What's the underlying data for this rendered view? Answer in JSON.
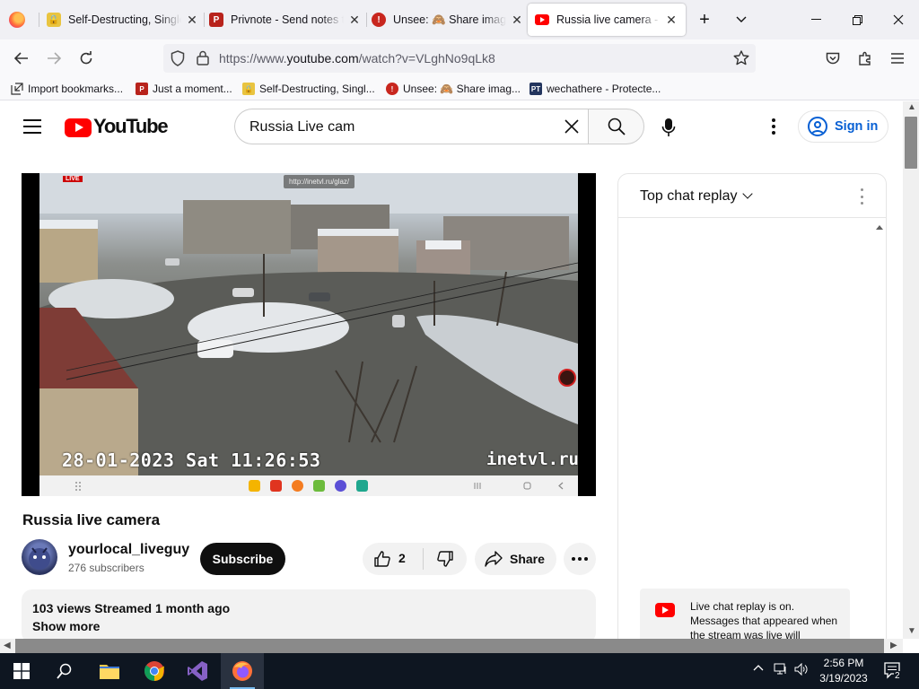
{
  "browser": {
    "tabs": [
      {
        "title": "Self-Destructing, Single",
        "favicon": "lock-gold-icon",
        "active": false
      },
      {
        "title": "Privnote - Send notes th",
        "favicon": "privnote-icon",
        "active": false
      },
      {
        "title": "Unsee: 🙈 Share image",
        "favicon": "unsee-icon",
        "active": false
      },
      {
        "title": "Russia live camera - You",
        "favicon": "youtube-icon",
        "active": true
      }
    ],
    "url": {
      "prefix": "https://www.",
      "domain": "youtube.com",
      "path": "/watch?v=VLghNo9qLk8"
    },
    "bookmarks": [
      {
        "label": "Import bookmarks...",
        "icon": "import-icon"
      },
      {
        "label": "Just a moment...",
        "icon": "privnote-icon"
      },
      {
        "label": "Self-Destructing, Singl...",
        "icon": "lock-gold-icon"
      },
      {
        "label": "Unsee: 🙈 Share imag...",
        "icon": "unsee-icon"
      },
      {
        "label": "wechathere - Protecte...",
        "icon": "pt-icon"
      }
    ],
    "pt_badge": "PT"
  },
  "youtube": {
    "logo_text": "YouTube",
    "search_value": "Russia Live cam",
    "sign_in_label": "Sign in"
  },
  "video": {
    "title": "Russia live camera",
    "overlay": {
      "timestamp": "28-01-2023 Sat 11:26:53",
      "brand": "inetvl.ru",
      "url": "http://inetvl.ru/glaz/",
      "live_badge": "LIVE"
    }
  },
  "channel": {
    "name": "yourlocal_liveguy",
    "subscribers": "276 subscribers",
    "subscribe_label": "Subscribe"
  },
  "actions": {
    "like_count": "2",
    "share_label": "Share"
  },
  "description": {
    "meta": "103 views  Streamed 1 month ago",
    "show_more": "Show more"
  },
  "chat": {
    "title": "Top chat replay",
    "notice": "Live chat replay is on. Messages that appeared when the stream was live will"
  },
  "taskbar": {
    "time": "2:56 PM",
    "date": "3/19/2023",
    "notification_count": "2"
  },
  "colors": {
    "youtube_red": "#ff0000",
    "link_blue": "#065fd4",
    "taskbar_bg": "#0e1621",
    "tab_strip_bg": "#f0f0f4"
  }
}
